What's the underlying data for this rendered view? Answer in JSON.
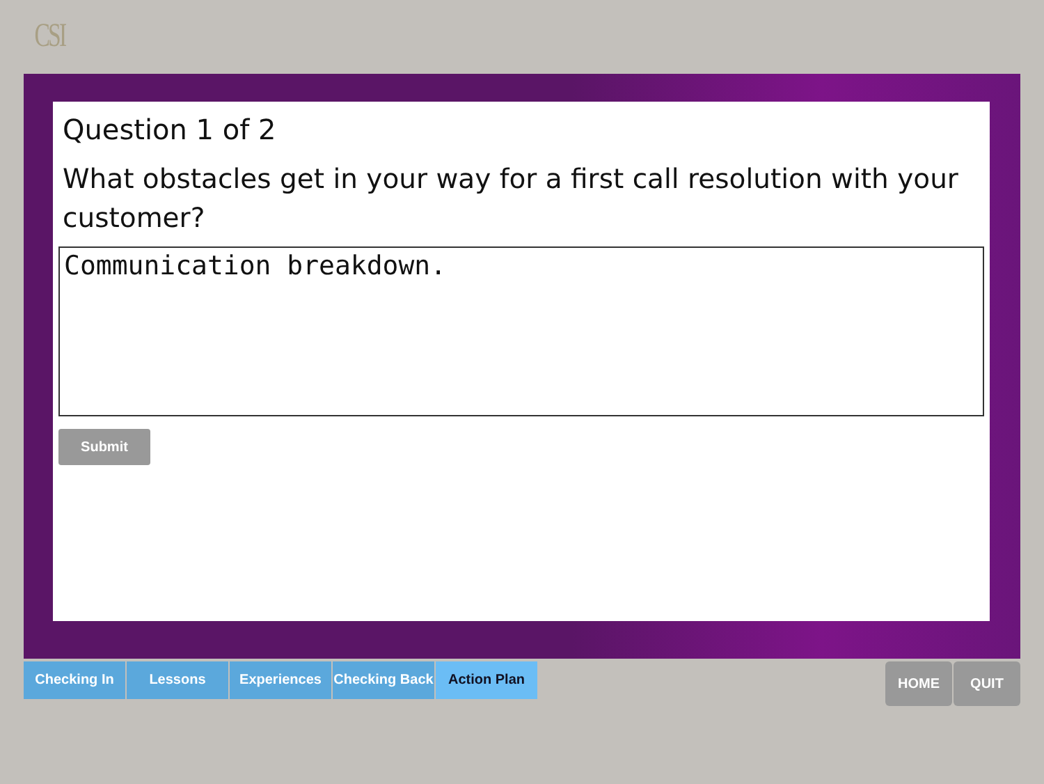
{
  "logo": "CSI",
  "question": {
    "counter": "Question 1 of 2",
    "prompt": "What obstacles get in your way for a first call resolution with your customer?",
    "answer": "Communication breakdown."
  },
  "submit": "Submit",
  "tabs": [
    {
      "label": "Checking In",
      "selected": false
    },
    {
      "label": "Lessons",
      "selected": false
    },
    {
      "label": "Experiences",
      "selected": false
    },
    {
      "label": "Checking Back",
      "selected": false
    },
    {
      "label": "Action Plan",
      "selected": true
    }
  ],
  "buttons": [
    "HOME",
    "QUIT"
  ]
}
